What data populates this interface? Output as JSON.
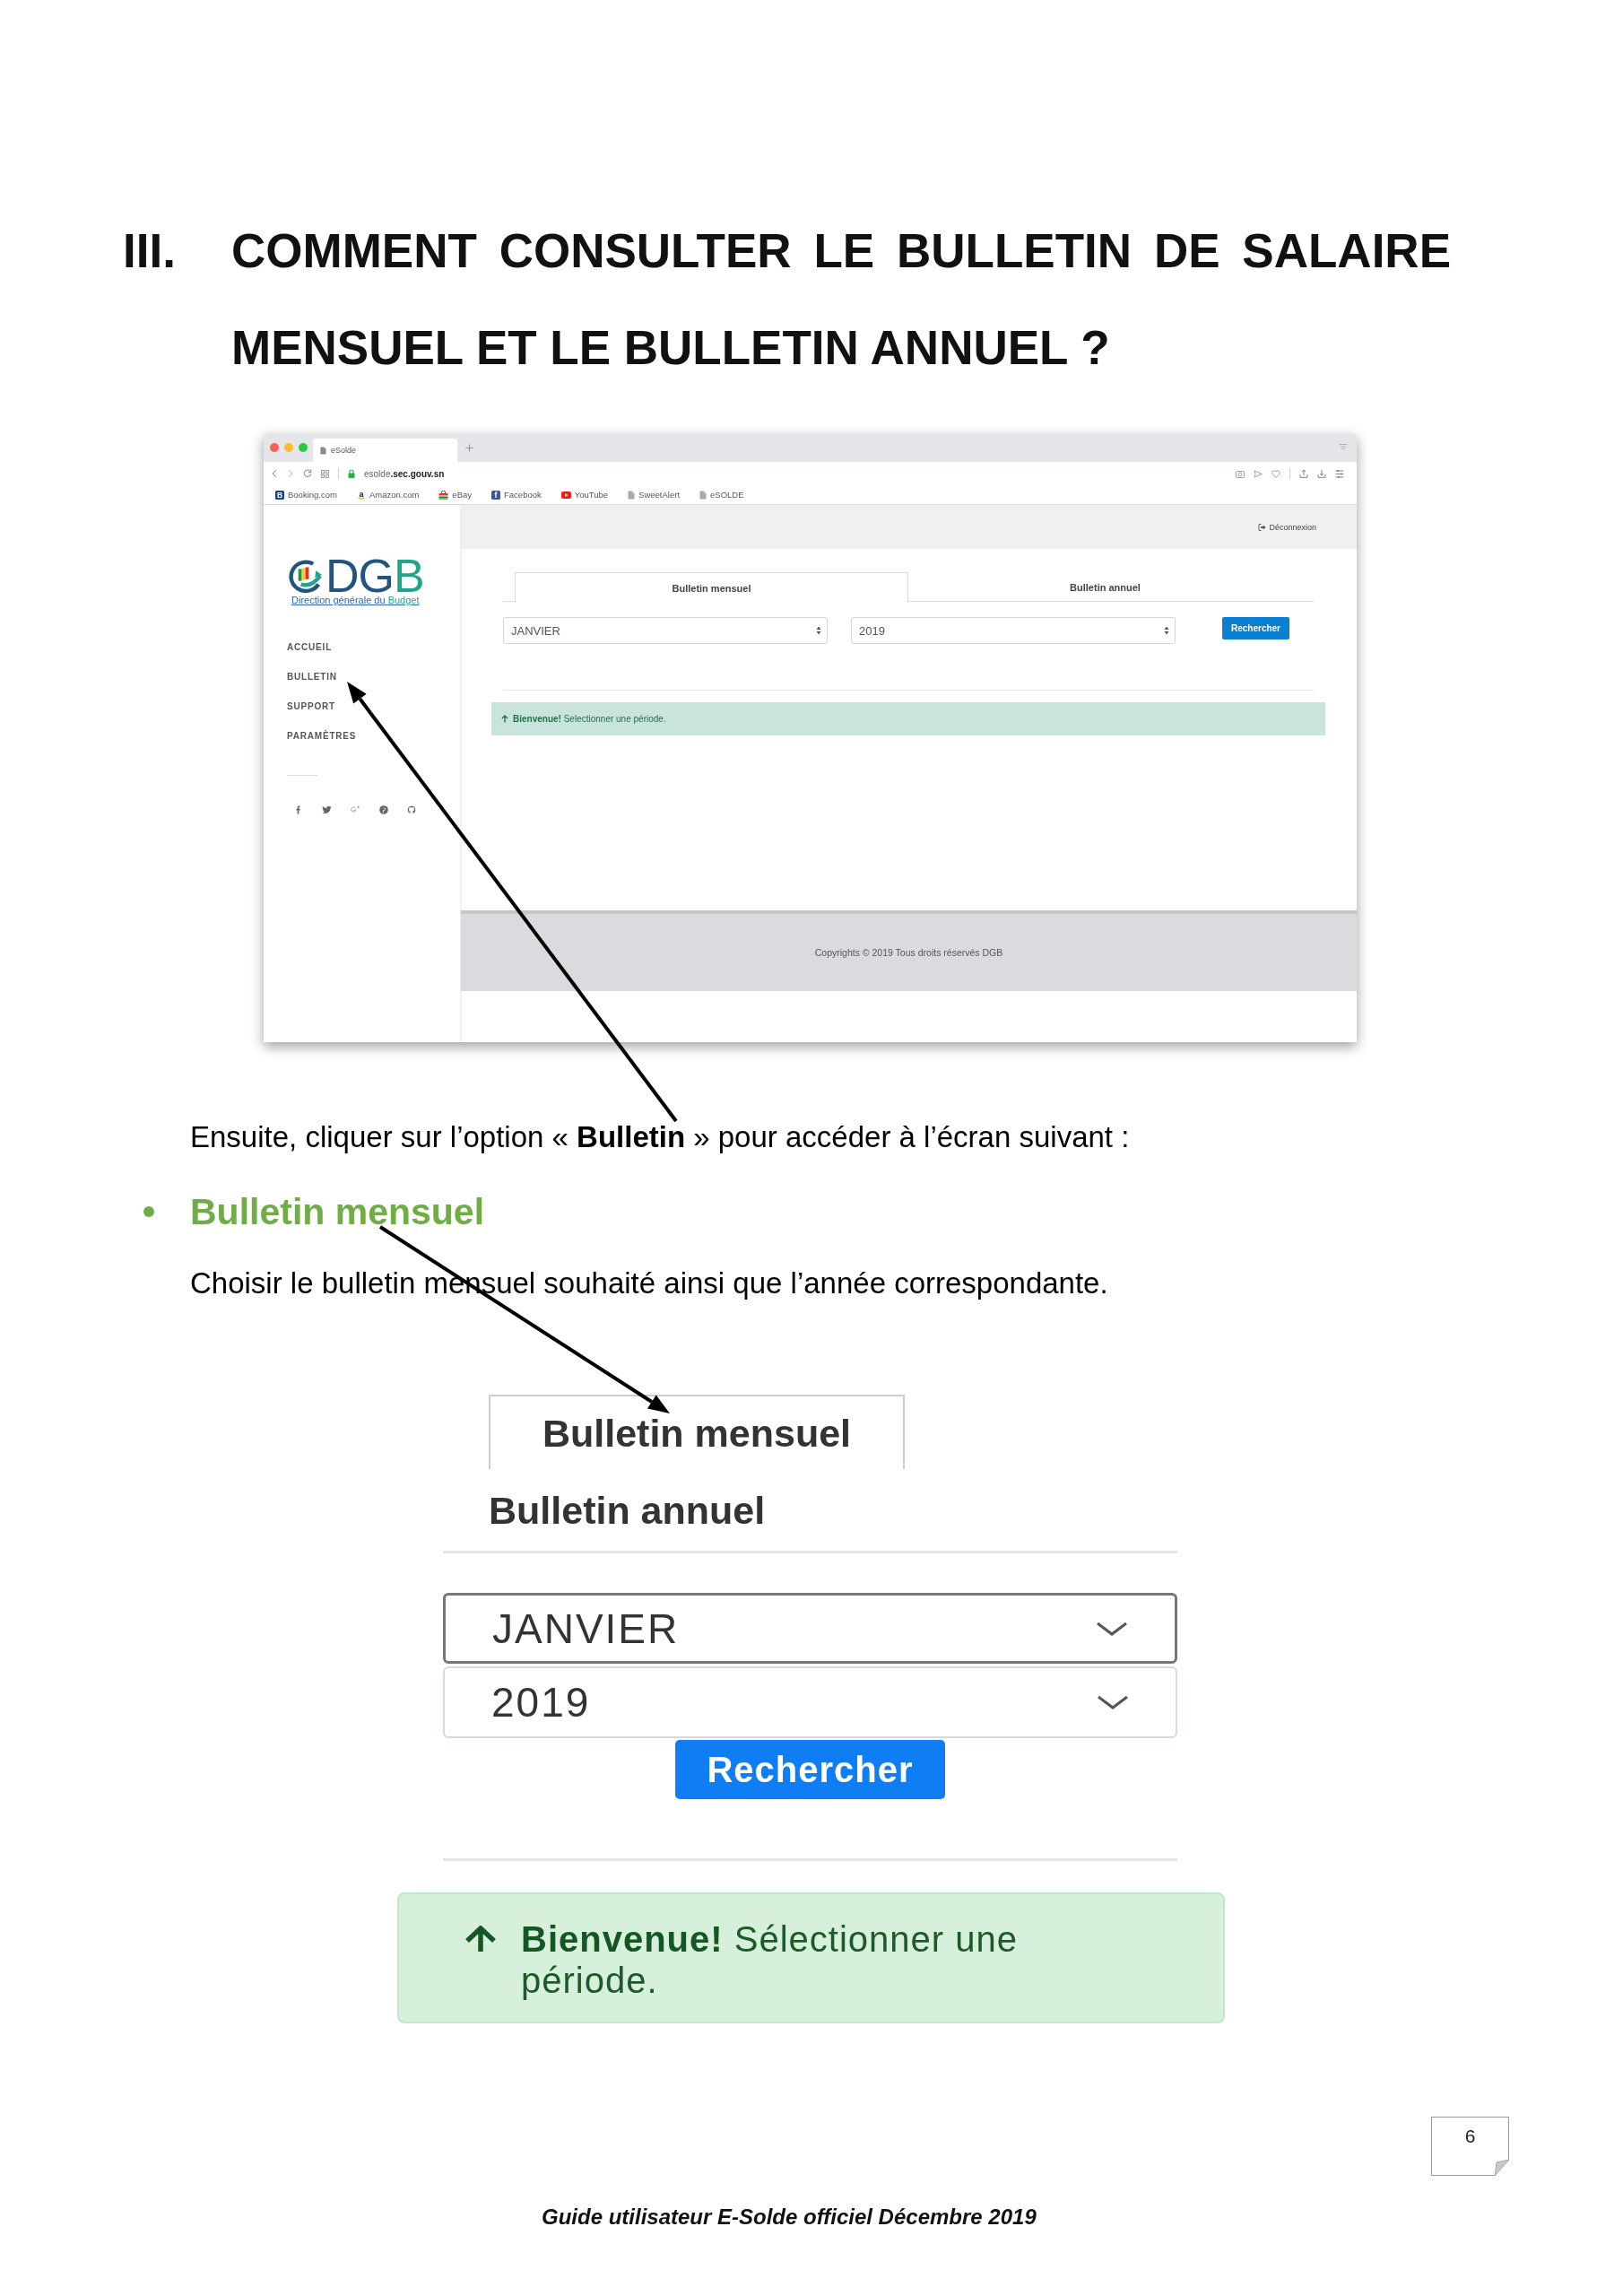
{
  "heading": {
    "number": "III.",
    "title": "COMMENT CONSULTER LE BULLETIN DE SALAIRE MENSUEL ET LE BULLETIN ANNUEL ?"
  },
  "screenshot": {
    "browser": {
      "tab_title": "eSolde",
      "address": "esolde**.sec.gouv.sn**",
      "bookmarks": [
        {
          "label": "Booking.com",
          "kind": "tile",
          "glyph": "B",
          "color": "#1d3f8f"
        },
        {
          "label": "Amazon.com",
          "kind": "letter",
          "glyph": "a"
        },
        {
          "label": "eBay",
          "kind": "bag"
        },
        {
          "label": "Facebook",
          "kind": "tile",
          "glyph": "f",
          "color": "#3b5998"
        },
        {
          "label": "YouTube",
          "kind": "play"
        },
        {
          "label": "SweetAlert",
          "kind": "page"
        },
        {
          "label": "eSOLDE",
          "kind": "page"
        }
      ]
    },
    "header": {
      "logout": "Déconnexion"
    },
    "sidebar": {
      "logo": {
        "letters": "DGB",
        "caption": "Direction générale du Budget"
      },
      "items": [
        "ACCUEIL",
        "BULLETIN",
        "SUPPORT",
        "PARAMÈTRES"
      ]
    },
    "tabs": [
      {
        "label": "Bulletin mensuel",
        "selected": true
      },
      {
        "label": "Bulletin annuel",
        "selected": false
      }
    ],
    "selects": [
      {
        "value": "JANVIER"
      },
      {
        "value": "2019"
      }
    ],
    "search_button": "Rechercher",
    "alert": "**Bienvenue!** Selectionner une période.",
    "footer": "Copyrights © 2019 Tous droits réservés DGB"
  },
  "paragraph_1": "Ensuite, cliquer sur l’option « **Bulletin** » pour accéder à l’écran suivant :",
  "section": {
    "title": "Bulletin mensuel",
    "text": "Choisir le bulletin mensuel souhaité ainsi que l’année correspondante."
  },
  "detail": {
    "tabs": [
      {
        "label": "Bulletin mensuel",
        "selected": true
      },
      {
        "label": "Bulletin annuel",
        "selected": false
      }
    ],
    "selects": [
      {
        "value": "JANVIER",
        "focused": true
      },
      {
        "value": "2019",
        "focused": false
      }
    ],
    "search_button": "Rechercher",
    "alert": "**Bienvenue!** Sélectionner une période."
  },
  "page_number": "6",
  "footer": "Guide utilisateur E-Solde officiel Décembre 2019"
}
